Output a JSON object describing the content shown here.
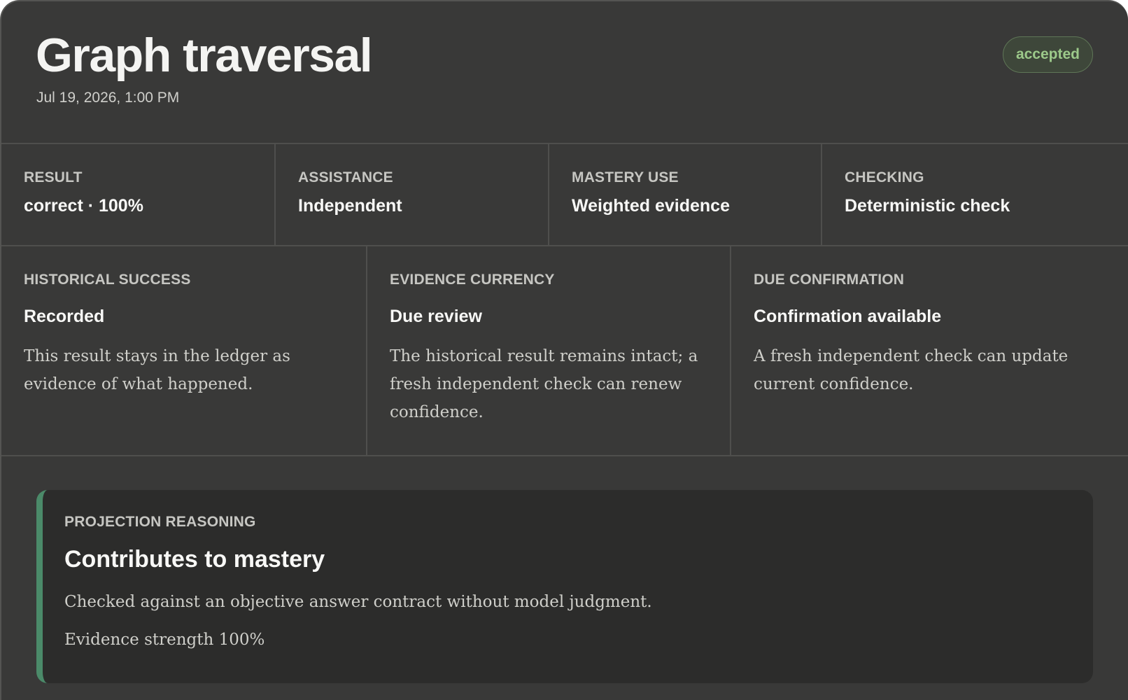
{
  "header": {
    "title": "Graph traversal",
    "timestamp": "Jul 19, 2026, 1:00 PM",
    "status": "accepted"
  },
  "summary": [
    {
      "label": "RESULT",
      "value": "correct · 100%"
    },
    {
      "label": "ASSISTANCE",
      "value": "Independent"
    },
    {
      "label": "MASTERY USE",
      "value": "Weighted evidence"
    },
    {
      "label": "CHECKING",
      "value": "Deterministic check"
    }
  ],
  "details": [
    {
      "label": "HISTORICAL SUCCESS",
      "heading": "Recorded",
      "text": "This result stays in the ledger as evidence of what happened."
    },
    {
      "label": "EVIDENCE CURRENCY",
      "heading": "Due review",
      "text": "The historical result remains intact; a fresh independent check can renew confidence."
    },
    {
      "label": "DUE CONFIRMATION",
      "heading": "Confirmation available",
      "text": "A fresh independent check can update current confidence."
    }
  ],
  "reasoning": {
    "label": "PROJECTION REASONING",
    "heading": "Contributes to mastery",
    "text": "Checked against an objective answer contract without model judgment.",
    "strength": "Evidence strength 100%"
  },
  "colors": {
    "card_background": "#393938",
    "panel_background": "#2c2c2b",
    "accent_green": "#4b8a69",
    "badge_text": "#9cc98a"
  }
}
